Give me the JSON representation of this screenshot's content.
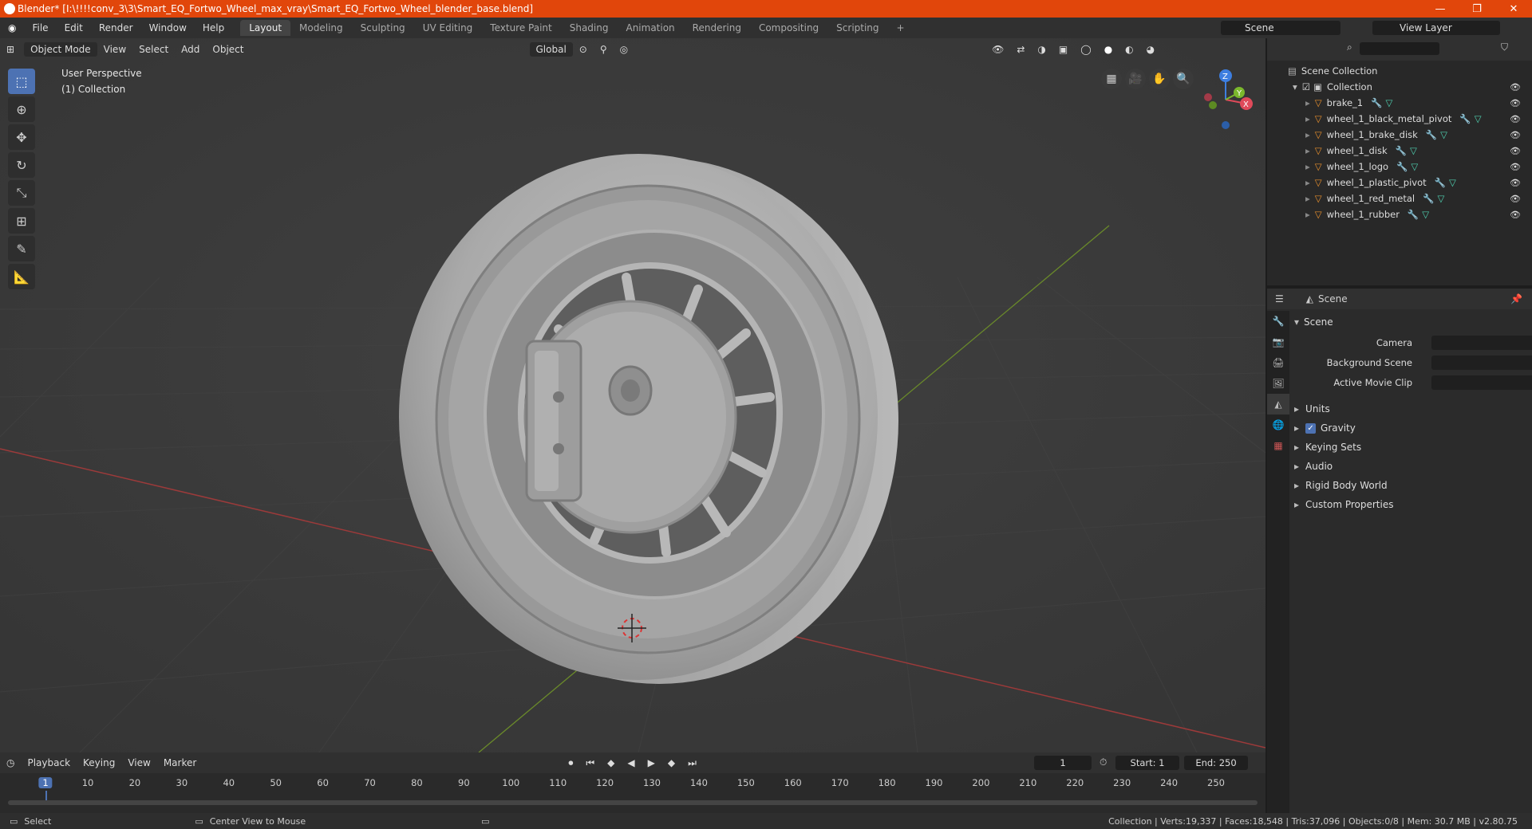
{
  "window": {
    "title": "Blender* [I:\\!!!!conv_3\\3\\Smart_EQ_Fortwo_Wheel_max_vray\\Smart_EQ_Fortwo_Wheel_blender_base.blend]",
    "controls": [
      "—",
      "❐",
      "✕"
    ]
  },
  "menu": [
    "File",
    "Edit",
    "Render",
    "Window",
    "Help"
  ],
  "workspaces": [
    "Layout",
    "Modeling",
    "Sculpting",
    "UV Editing",
    "Texture Paint",
    "Shading",
    "Animation",
    "Rendering",
    "Compositing",
    "Scripting"
  ],
  "scene_selector": "Scene",
  "view_layer": "View Layer",
  "viewport": {
    "mode": "Object Mode",
    "menus": [
      "View",
      "Select",
      "Add",
      "Object"
    ],
    "orientation": "Global",
    "perspective_label": "User Perspective",
    "collection_label": "(1) Collection",
    "gizmo_axes": [
      "Z",
      "Y",
      "X"
    ]
  },
  "outliner": {
    "root": "Scene Collection",
    "collection": "Collection",
    "items": [
      "brake_1",
      "wheel_1_black_metal_pivot",
      "wheel_1_brake_disk",
      "wheel_1_disk",
      "wheel_1_logo",
      "wheel_1_plastic_pivot",
      "wheel_1_red_metal",
      "wheel_1_rubber"
    ]
  },
  "properties": {
    "header": "Scene",
    "section": "Scene",
    "fields": [
      {
        "label": "Camera"
      },
      {
        "label": "Background Scene"
      },
      {
        "label": "Active Movie Clip"
      }
    ],
    "panels": [
      "Units",
      "Gravity",
      "Keying Sets",
      "Audio",
      "Rigid Body World",
      "Custom Properties"
    ]
  },
  "timeline": {
    "menus": [
      "Playback",
      "Keying",
      "View",
      "Marker"
    ],
    "current_frame": "1",
    "start_label": "Start:",
    "start": "1",
    "end_label": "End:",
    "end": "250",
    "frame_marks": [
      "1",
      "10",
      "20",
      "30",
      "40",
      "50",
      "60",
      "70",
      "80",
      "90",
      "100",
      "110",
      "120",
      "130",
      "140",
      "150",
      "160",
      "170",
      "180",
      "190",
      "200",
      "210",
      "220",
      "230",
      "240",
      "250"
    ]
  },
  "statusbar": {
    "left": "Select",
    "middle": "Center View to Mouse",
    "right": "Collection | Verts:19,337 | Faces:18,548 | Tris:37,096 | Objects:0/8 | Mem: 30.7 MB | v2.80.75"
  }
}
